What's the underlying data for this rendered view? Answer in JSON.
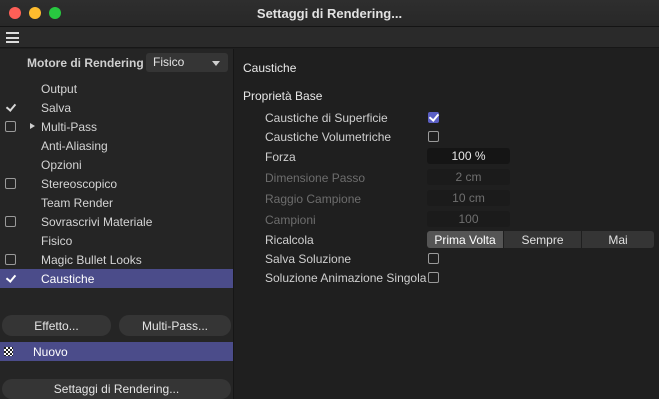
{
  "window": {
    "title": "Settaggi di Rendering..."
  },
  "engine": {
    "label": "Motore di Rendering",
    "value": "Fisico"
  },
  "sidebar": {
    "items": [
      {
        "label": "Output",
        "checkbox": false,
        "checked": false,
        "expandable": false,
        "selected": false
      },
      {
        "label": "Salva",
        "checkbox": true,
        "checked": true,
        "expandable": false,
        "selected": false
      },
      {
        "label": "Multi-Pass",
        "checkbox": true,
        "checked": false,
        "expandable": true,
        "selected": false
      },
      {
        "label": "Anti-Aliasing",
        "checkbox": false,
        "checked": false,
        "expandable": false,
        "selected": false
      },
      {
        "label": "Opzioni",
        "checkbox": false,
        "checked": false,
        "expandable": false,
        "selected": false
      },
      {
        "label": "Stereoscopico",
        "checkbox": true,
        "checked": false,
        "expandable": false,
        "selected": false
      },
      {
        "label": "Team Render",
        "checkbox": false,
        "checked": false,
        "expandable": false,
        "selected": false
      },
      {
        "label": "Sovrascrivi Materiale",
        "checkbox": true,
        "checked": false,
        "expandable": false,
        "selected": false
      },
      {
        "label": "Fisico",
        "checkbox": false,
        "checked": false,
        "expandable": false,
        "selected": false
      },
      {
        "label": "Magic Bullet Looks",
        "checkbox": true,
        "checked": false,
        "expandable": false,
        "selected": false
      },
      {
        "label": "Caustiche",
        "checkbox": true,
        "checked": true,
        "expandable": false,
        "selected": true
      }
    ],
    "effect_button": "Effetto...",
    "multipass_button": "Multi-Pass...",
    "preset": "Nuovo",
    "settings_button": "Settaggi di Rendering..."
  },
  "panel": {
    "title": "Caustiche",
    "group": "Proprietà Base",
    "surface_caustics": {
      "label": "Caustiche di Superficie",
      "checked": true
    },
    "volume_caustics": {
      "label": "Caustiche Volumetriche",
      "checked": false
    },
    "strength": {
      "label": "Forza",
      "value": "100 %"
    },
    "step_size": {
      "label": "Dimensione Passo",
      "value": "2 cm"
    },
    "sample_radius": {
      "label": "Raggio Campione",
      "value": "10 cm"
    },
    "samples": {
      "label": "Campioni",
      "value": "100"
    },
    "recompute": {
      "label": "Ricalcola",
      "options": [
        "Prima Volta",
        "Sempre",
        "Mai"
      ],
      "selected": "Prima Volta"
    },
    "save_solution": {
      "label": "Salva Soluzione",
      "checked": false
    },
    "single_animation_solution": {
      "label": "Soluzione Animazione Singola",
      "checked": false
    }
  },
  "colors": {
    "selection": "#4b4c8a",
    "checkbox_accent": "#5b5fc4"
  }
}
